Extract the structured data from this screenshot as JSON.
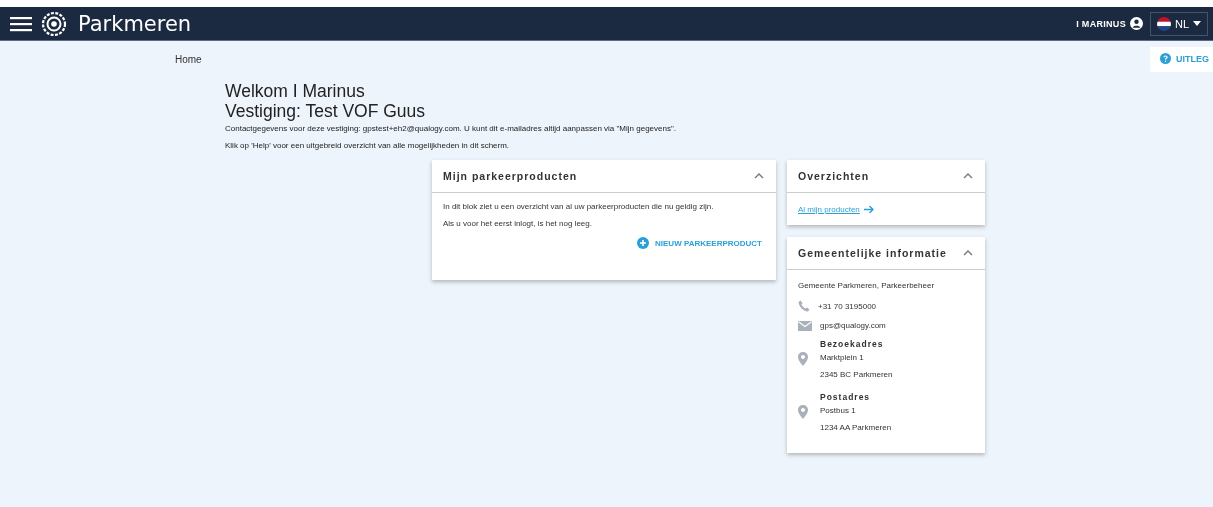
{
  "header": {
    "brand": "Parkmeren",
    "user": "I MARINUS",
    "language": "NL"
  },
  "breadcrumb": "Home",
  "help_button": "UITLEG",
  "welcome": {
    "greeting": "Welkom I Marinus",
    "branch": "Vestiging: Test VOF Guus",
    "contact": "Contactgegevens voor deze vestiging: gpstest+eh2@qualogy.com. U kunt dit e-mailadres altijd aanpassen via \"Mijn gegevens\".",
    "hint": "Klik op 'Help' voor een uitgebreid overzicht van alle mogelijkheden in dit scherm."
  },
  "products_card": {
    "title": "Mijn parkeerproducten",
    "expanded": true,
    "lines": [
      "In dit blok ziet u een overzicht van al uw parkeerproducten die nu geldig zijn.",
      "Als u voor het eerst inlogt, is het nog leeg."
    ],
    "action": "NIEUW PARKEERPRODUCT"
  },
  "overview_card": {
    "title": "Overzichten",
    "expanded": true,
    "link": "Al mijn producten"
  },
  "info_card": {
    "title": "Gemeentelijke informatie",
    "expanded": true,
    "organisation": "Gemeente Parkmeren, Parkeerbeheer",
    "phone": "+31 70 3195000",
    "email": "gps@qualogy.com",
    "addresses": [
      {
        "label": "Bezoekadres",
        "lines": [
          "Marktplein 1",
          "2345 BC Parkmeren"
        ]
      },
      {
        "label": "Postadres",
        "lines": [
          "Postbus 1",
          "1234 AA Parkmeren"
        ]
      }
    ]
  }
}
